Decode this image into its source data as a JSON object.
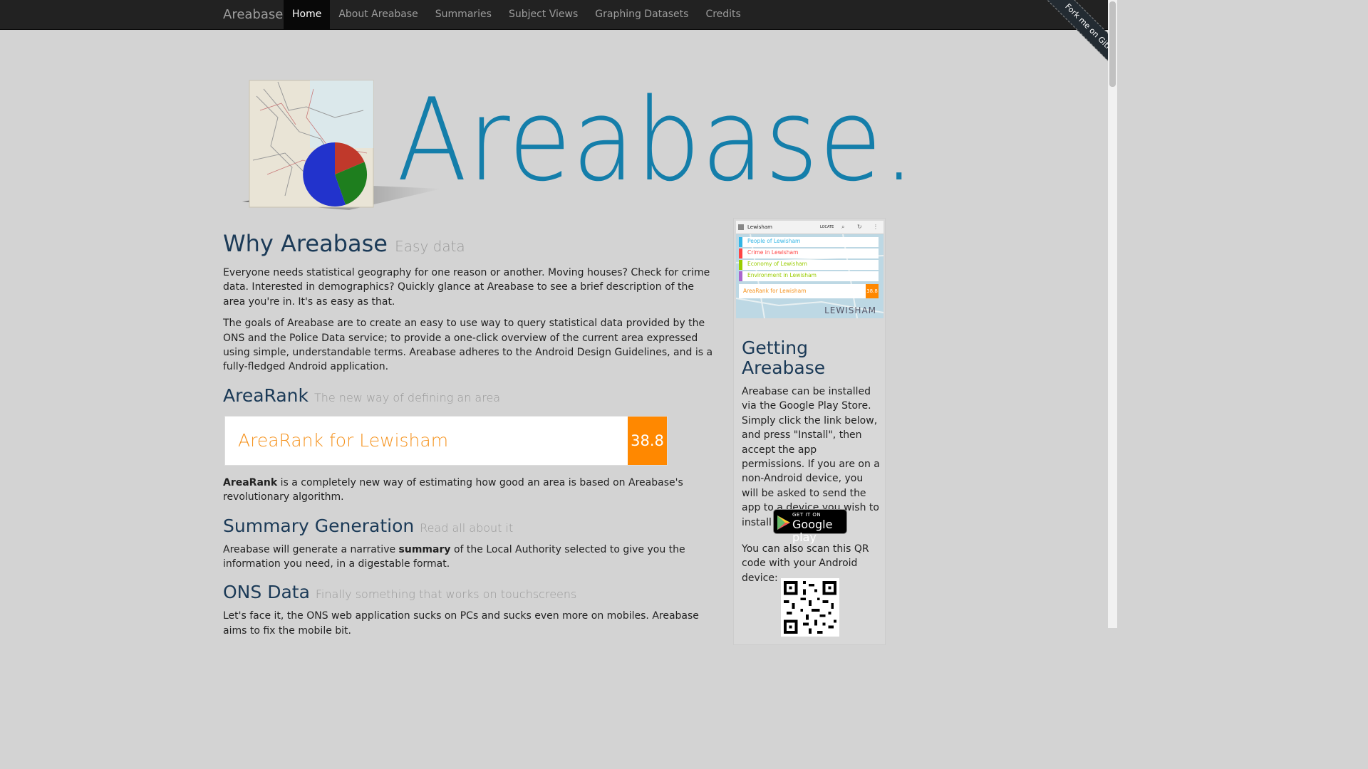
{
  "nav": {
    "brand": "Areabase",
    "items": [
      {
        "label": "Home",
        "active": true
      },
      {
        "label": "About Areabase",
        "active": false
      },
      {
        "label": "Summaries",
        "active": false
      },
      {
        "label": "Subject Views",
        "active": false
      },
      {
        "label": "Graphing Datasets",
        "active": false
      },
      {
        "label": "Credits",
        "active": false
      }
    ],
    "ribbon": "Fork me on GitHub"
  },
  "hero": {
    "title": "Areabase."
  },
  "sections": {
    "why": {
      "title": "Why Areabase",
      "subtitle": "Easy data",
      "p1": "Everyone needs statistical geography for one reason or another. Moving houses? Check for crime data. Interested in demographics? Quickly glance at Areabase to see a brief description of the area you're in. It's as easy as that.",
      "p2": "The goals of Areabase are to create an easy to use way to query statistical data provided by the ONS and the Police Data service; to provide a one-click overview of the current area expressed using simple, understandable terms. Areabase adheres to the Android Design Guidelines, and is a fully-fledged Android application."
    },
    "arearank": {
      "title": "AreaRank",
      "subtitle": "The new way of defining an area",
      "widget_label": "AreaRank for Lewisham",
      "widget_score": "38.8",
      "text_bold": "AreaRank",
      "text_rest": " is a completely new way of estimating how good an area is based on Areabase's revolutionary algorithm."
    },
    "summary": {
      "title": "Summary Generation",
      "subtitle": "Read all about it",
      "text_a": "Areabase will generate a narrative ",
      "text_bold": "summary",
      "text_b": " of the Local Authority selected to give you the information you need, in a digestable format."
    },
    "ons": {
      "title": "ONS Data",
      "subtitle": "Finally something that works on touchscreens",
      "text": "Let's face it, the ONS web application sucks on PCs and sucks even more on mobiles. Areabase aims to fix the mobile bit."
    }
  },
  "sidebar": {
    "screenshot": {
      "place": "Lewisham",
      "locate": "LOCATE",
      "cards": [
        {
          "label": "People of Lewisham",
          "color": "#33b5e5"
        },
        {
          "label": "Crime in Lewisham",
          "color": "#ff4444"
        },
        {
          "label": "Economy of Lewisham",
          "color": "#99cc00"
        },
        {
          "label": "Environment in Lewisham",
          "color": "#aa66cc"
        }
      ],
      "rank_label": "AreaRank for Lewisham",
      "rank_score": "38.8",
      "map_label": "LEWISHAM"
    },
    "title": "Getting Areabase",
    "install_text": "Areabase can be installed via the Google Play Store. Simply click the link below, and press \"Install\", then accept the app permissions. If you are on a non-Android device, you will be asked to send the app to a device you wish to install it on.",
    "play_small": "GET IT ON",
    "play_big": "Google play",
    "qr_text": "You can also scan this QR code with your Android device:"
  }
}
